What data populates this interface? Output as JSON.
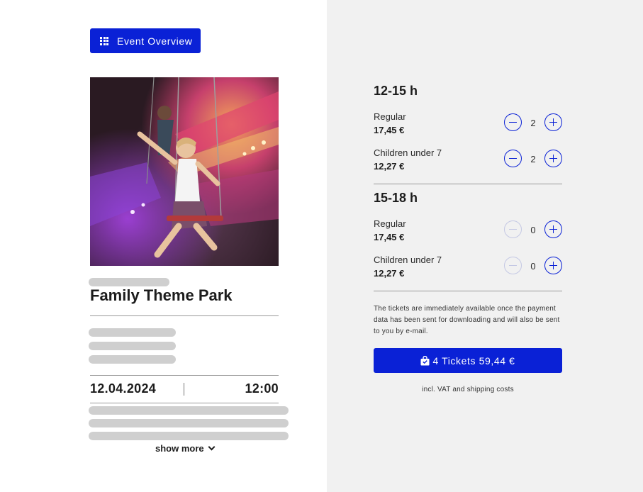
{
  "header": {
    "overview_label": "Event Overview"
  },
  "event": {
    "title": "Family Theme Park",
    "date": "12.04.2024",
    "time": "12:00",
    "show_more_label": "show more"
  },
  "slots": [
    {
      "title": "12-15 h",
      "tickets": [
        {
          "name": "Regular",
          "price": "17,45 €",
          "quantity": "2"
        },
        {
          "name": "Children under 7",
          "price": "12,27 €",
          "quantity": "2"
        }
      ]
    },
    {
      "title": "15-18 h",
      "tickets": [
        {
          "name": "Regular",
          "price": "17,45 €",
          "quantity": "0"
        },
        {
          "name": "Children under 7",
          "price": "12,27 €",
          "quantity": "0"
        }
      ]
    }
  ],
  "info_text": "The tickets are immediately available once the payment data has been sent for downloading and will also be sent to you by e-mail.",
  "checkout": {
    "button_label": "4 Tickets 59,44 €",
    "vat_note": "incl. VAT and shipping costs"
  },
  "colors": {
    "accent": "#0a21d6",
    "panel_bg": "#f1f1f1",
    "skeleton": "#cfcfcf"
  }
}
